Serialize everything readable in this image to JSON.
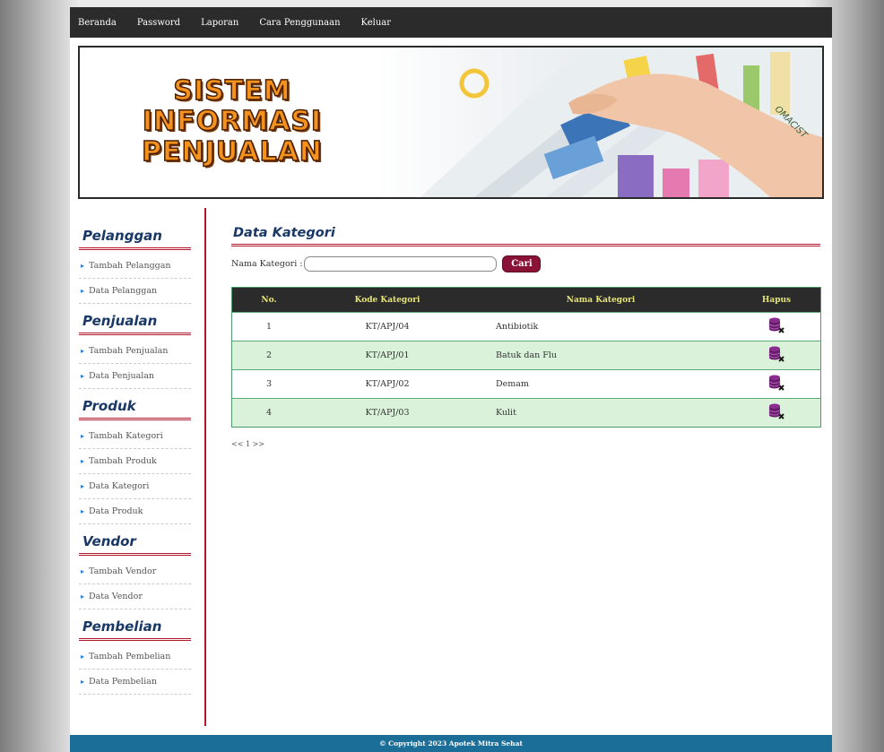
{
  "topnav": {
    "items": [
      "Beranda",
      "Password",
      "Laporan",
      "Cara Penggunaan",
      "Keluar"
    ]
  },
  "banner": {
    "title_lines": [
      "SISTEM",
      "INFORMASI",
      "PENJUALAN"
    ],
    "tag": "OMACIST"
  },
  "sidebar": {
    "sections": [
      {
        "title": "Pelanggan",
        "items": [
          "Tambah Pelanggan",
          "Data Pelanggan"
        ]
      },
      {
        "title": "Penjualan",
        "items": [
          "Tambah Penjualan",
          "Data Penjualan"
        ]
      },
      {
        "title": "Produk",
        "items": [
          "Tambah Kategori",
          "Tambah Produk",
          "Data Kategori",
          "Data Produk"
        ]
      },
      {
        "title": "Vendor",
        "items": [
          "Tambah Vendor",
          "Data Vendor"
        ]
      },
      {
        "title": "Pembelian",
        "items": [
          "Tambah Pembelian",
          "Data Pembelian"
        ]
      }
    ]
  },
  "main": {
    "title": "Data Kategori",
    "search_label": "Nama Kategori :",
    "search_value": "",
    "search_button": "Cari",
    "columns": [
      "No.",
      "Kode Kategori",
      "Nama Kategori",
      "Hapus"
    ],
    "rows": [
      {
        "no": "1",
        "kode": "KT/APJ/04",
        "nama": "Antibiotik"
      },
      {
        "no": "2",
        "kode": "KT/APJ/01",
        "nama": "Batuk dan Flu"
      },
      {
        "no": "3",
        "kode": "KT/APJ/02",
        "nama": "Demam"
      },
      {
        "no": "4",
        "kode": "KT/APJ/03",
        "nama": "Kulit"
      }
    ],
    "delete_icon": "database-delete-icon",
    "pager": "<< 1 >>"
  },
  "footer": {
    "text": "© Copyright 2023 Apotek Mitra Sehat"
  },
  "colors": {
    "nav_bg": "#2b2b2b",
    "accent_red": "#b2182b",
    "heading_blue": "#1a3866",
    "button": "#8a1236",
    "row_alt": "#d9f2d9",
    "footer_bg": "#1a6e98",
    "header_text": "#e7e47a"
  }
}
